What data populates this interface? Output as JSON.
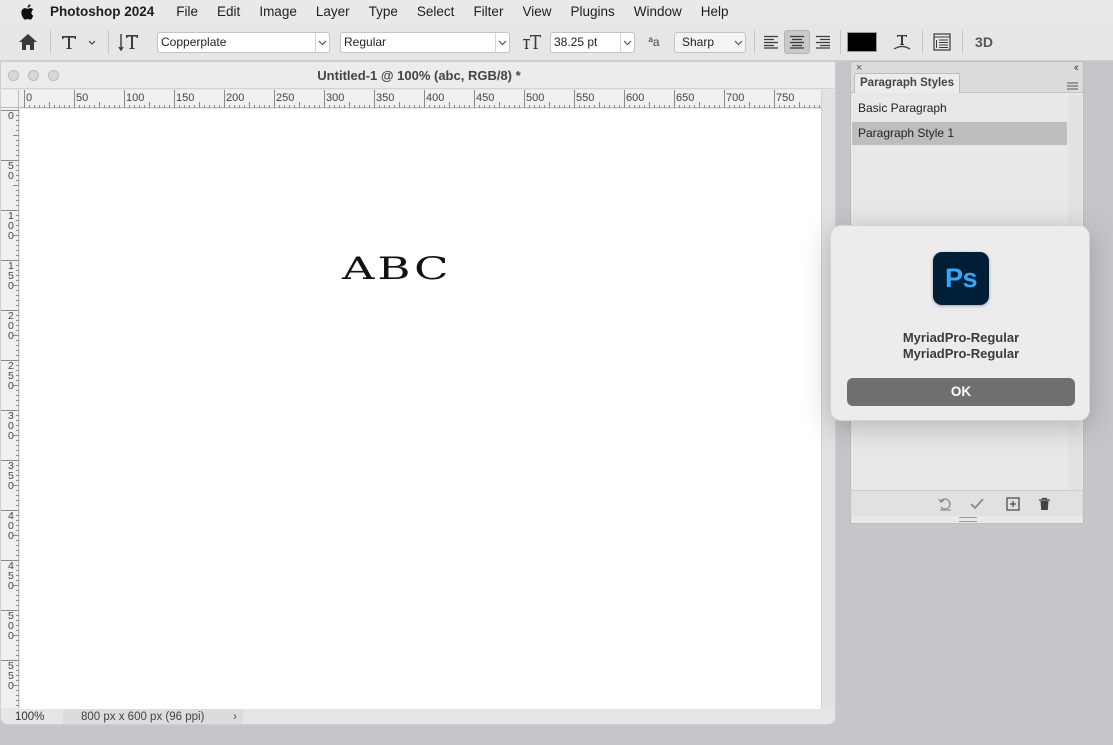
{
  "menubar": {
    "app_name": "Photoshop 2024",
    "items": [
      "File",
      "Edit",
      "Image",
      "Layer",
      "Type",
      "Select",
      "Filter",
      "View",
      "Plugins",
      "Window",
      "Help"
    ]
  },
  "options_bar": {
    "font_family": "Copperplate",
    "font_style": "Regular",
    "font_size": "38.25 pt",
    "antialias_icon_text": "ªa",
    "antialias": "Sharp",
    "text_color": "#000000",
    "threed_label": "3D"
  },
  "document": {
    "title": "Untitled-1 @ 100% (abc, RGB/8) *",
    "canvas_text": "ABC",
    "zoom": "100%",
    "doc_info": "800 px x 600 px (96 ppi)",
    "status_arrow": "›",
    "ruler_top_labels": [
      "0",
      "50",
      "100",
      "150",
      "200",
      "250",
      "300",
      "350",
      "400",
      "450",
      "500",
      "550",
      "600",
      "650",
      "700",
      "750"
    ],
    "ruler_left_labels": [
      "0",
      "50",
      "100",
      "150",
      "200",
      "250",
      "300",
      "350",
      "400",
      "450",
      "500",
      "550"
    ]
  },
  "paragraph_panel": {
    "tab_label": "Paragraph Styles",
    "styles": [
      "Basic Paragraph",
      "Paragraph Style 1"
    ],
    "selected_index": 1
  },
  "dialog": {
    "icon_text": "Ps",
    "message_line1": "MyriadPro-Regular",
    "message_line2": "MyriadPro-Regular",
    "ok_label": "OK"
  },
  "colors": {
    "ps_icon_bg": "#001e36",
    "ps_icon_fg": "#31a8ff",
    "selected_row": "#bdbdbd"
  }
}
